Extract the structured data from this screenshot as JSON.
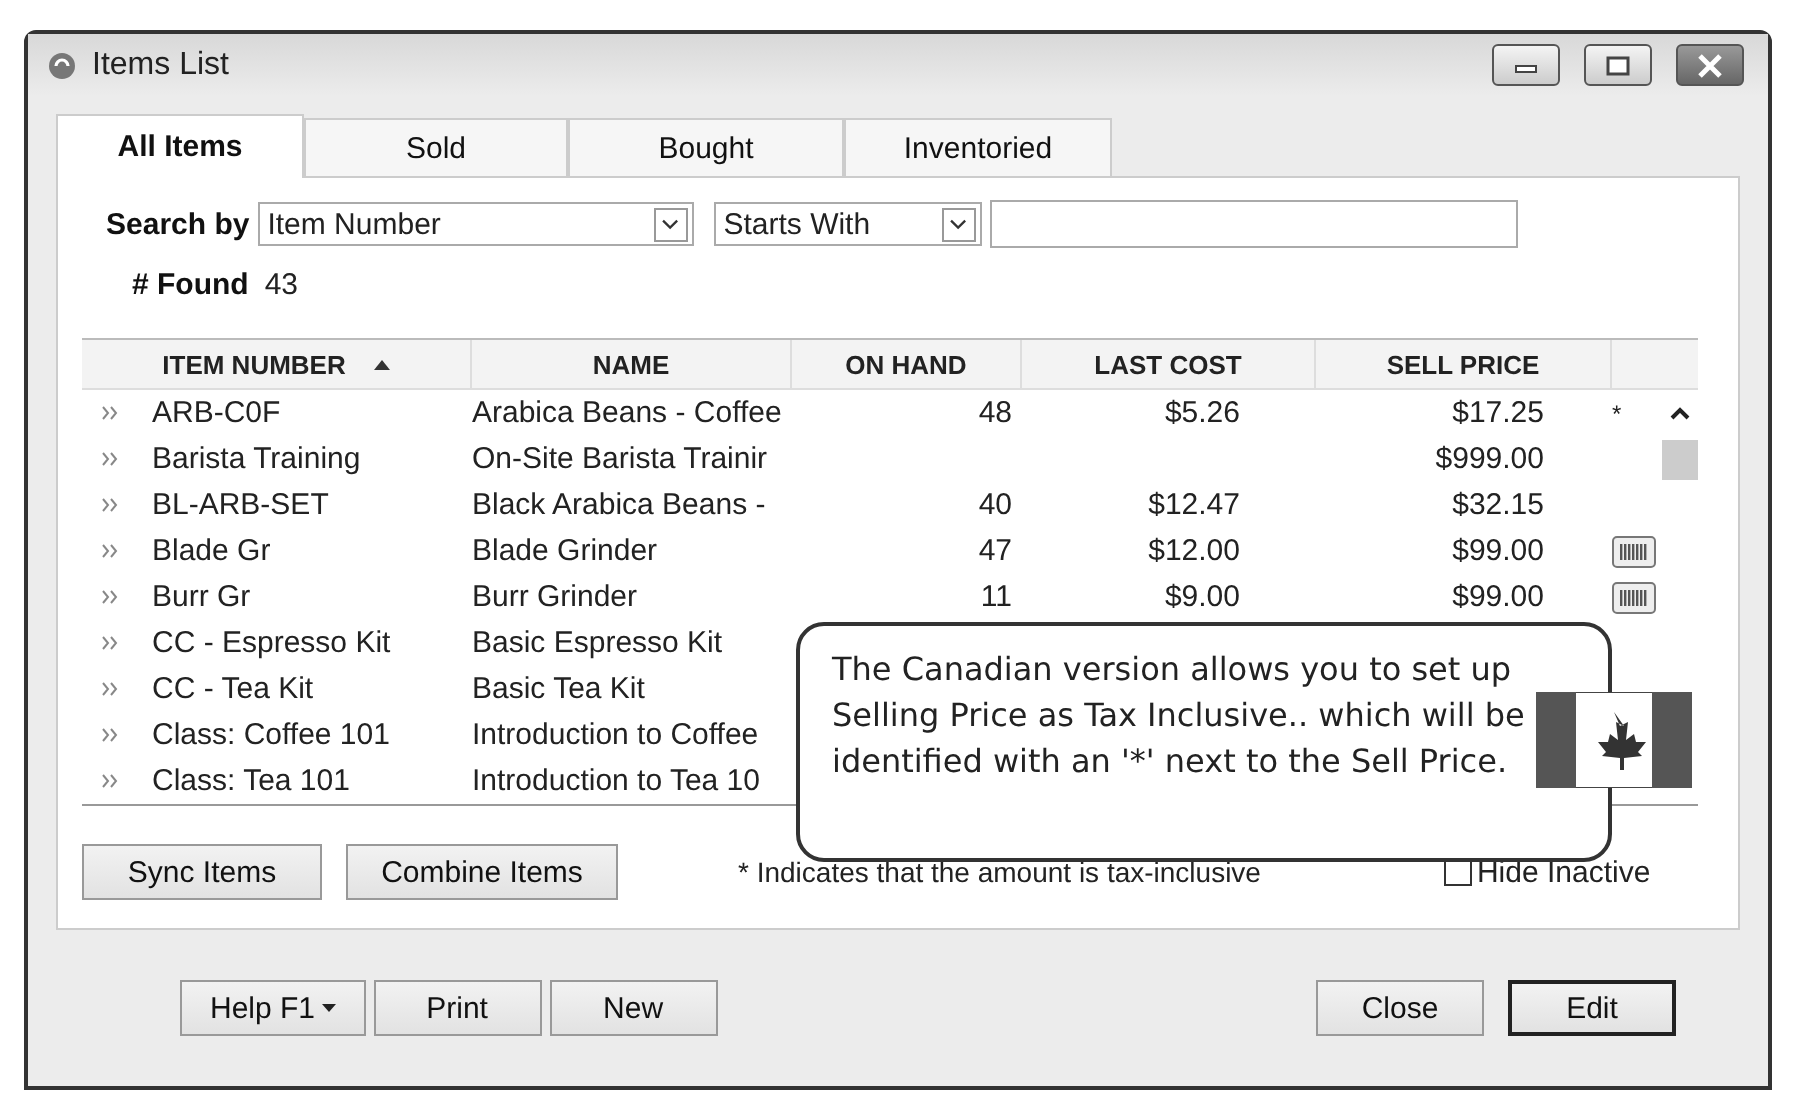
{
  "window": {
    "title": "Items List"
  },
  "tabs": [
    {
      "label": "All Items",
      "selected": true
    },
    {
      "label": "Sold",
      "selected": false
    },
    {
      "label": "Bought",
      "selected": false
    },
    {
      "label": "Inventoried",
      "selected": false
    }
  ],
  "search": {
    "label": "Search by",
    "field": "Item Number",
    "mode": "Starts With",
    "found_label": "# Found",
    "found": "43"
  },
  "table": {
    "columns": [
      "ITEM NUMBER",
      "NAME",
      "ON HAND",
      "LAST COST",
      "SELL PRICE"
    ],
    "rows": [
      {
        "item_number": "ARB-C0F",
        "name": "Arabica Beans - Coffee",
        "on_hand": "48",
        "last_cost": "$5.26",
        "sell_price": "$17.25",
        "tax_mark": "*",
        "barcode": false
      },
      {
        "item_number": "Barista Training",
        "name": "On-Site Barista Trainir",
        "sell_price": "$999.00",
        "barcode": false
      },
      {
        "item_number": "BL-ARB-SET",
        "name": "Black Arabica Beans -",
        "on_hand": "40",
        "last_cost": "$12.47",
        "sell_price": "$32.15",
        "barcode": false
      },
      {
        "item_number": "Blade Gr",
        "name": "Blade Grinder",
        "on_hand": "47",
        "last_cost": "$12.00",
        "sell_price": "$99.00",
        "barcode": true
      },
      {
        "item_number": "Burr Gr",
        "name": "Burr Grinder",
        "on_hand": "11",
        "last_cost": "$9.00",
        "sell_price": "$99.00",
        "barcode": true
      },
      {
        "item_number": "CC - Espresso Kit",
        "name": "Basic Espresso Kit",
        "barcode": false
      },
      {
        "item_number": "CC - Tea Kit",
        "name": "Basic Tea Kit",
        "barcode": false
      },
      {
        "item_number": "Class: Coffee 101",
        "name": "Introduction to Coffee",
        "barcode": false
      },
      {
        "item_number": "Class: Tea 101",
        "name": "Introduction to Tea 10",
        "barcode": false
      }
    ]
  },
  "callout": {
    "text": "The Canadian version allows you to set up Selling Price as Tax Inclusive.. which will be identified with an '*' next to the Sell Price."
  },
  "actions": [
    "Sync Items",
    "Combine Items"
  ],
  "footnote": "* Indicates that the amount is tax-inclusive",
  "hide_inactive": {
    "label": "Hide Inactive",
    "checked": false
  },
  "footer_left": [
    "Help F1",
    "Print",
    "New"
  ],
  "footer_right": [
    {
      "label": "Close",
      "default": false
    },
    {
      "label": "Edit",
      "default": true
    }
  ]
}
